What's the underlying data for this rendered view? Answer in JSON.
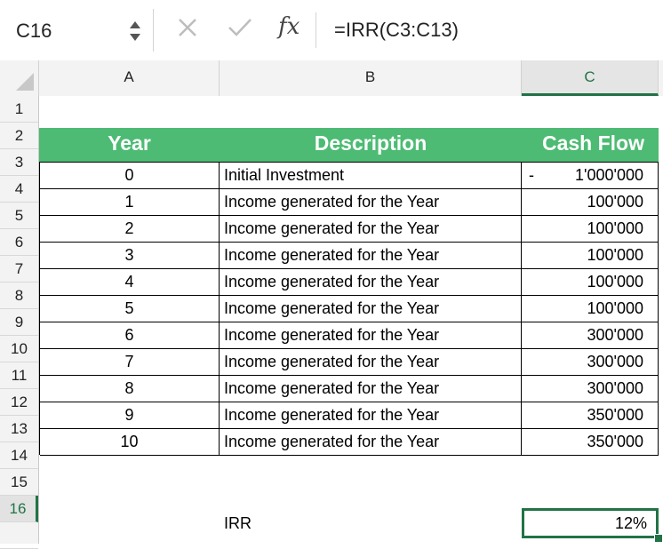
{
  "name_box": "C16",
  "formula": "=IRR(C3:C13)",
  "icons": {
    "cancel": "x-mark",
    "confirm": "check-mark",
    "function": "fx"
  },
  "fx_label": "fx",
  "columns": [
    "A",
    "B",
    "C"
  ],
  "row_numbers": [
    "1",
    "2",
    "3",
    "4",
    "5",
    "6",
    "7",
    "8",
    "9",
    "10",
    "11",
    "12",
    "13",
    "14",
    "15",
    "16"
  ],
  "headers": {
    "year": "Year",
    "description": "Description",
    "cash_flow": "Cash Flow"
  },
  "rows": [
    {
      "year": "0",
      "description": "Initial Investment",
      "sign": "-",
      "cash_flow": "1'000'000"
    },
    {
      "year": "1",
      "description": "Income generated for the Year",
      "sign": "",
      "cash_flow": "100'000"
    },
    {
      "year": "2",
      "description": "Income generated for the Year",
      "sign": "",
      "cash_flow": "100'000"
    },
    {
      "year": "3",
      "description": "Income generated for the Year",
      "sign": "",
      "cash_flow": "100'000"
    },
    {
      "year": "4",
      "description": "Income generated for the Year",
      "sign": "",
      "cash_flow": "100'000"
    },
    {
      "year": "5",
      "description": "Income generated for the Year",
      "sign": "",
      "cash_flow": "100'000"
    },
    {
      "year": "6",
      "description": "Income generated for the Year",
      "sign": "",
      "cash_flow": "300'000"
    },
    {
      "year": "7",
      "description": "Income generated for the Year",
      "sign": "",
      "cash_flow": "300'000"
    },
    {
      "year": "8",
      "description": "Income generated for the Year",
      "sign": "",
      "cash_flow": "300'000"
    },
    {
      "year": "9",
      "description": "Income generated for the Year",
      "sign": "",
      "cash_flow": "350'000"
    },
    {
      "year": "10",
      "description": "Income generated for the Year",
      "sign": "",
      "cash_flow": "350'000"
    }
  ],
  "irr": {
    "label": "IRR",
    "value": "12%"
  },
  "colors": {
    "header_fill": "#4dbb73",
    "selection": "#217346"
  }
}
